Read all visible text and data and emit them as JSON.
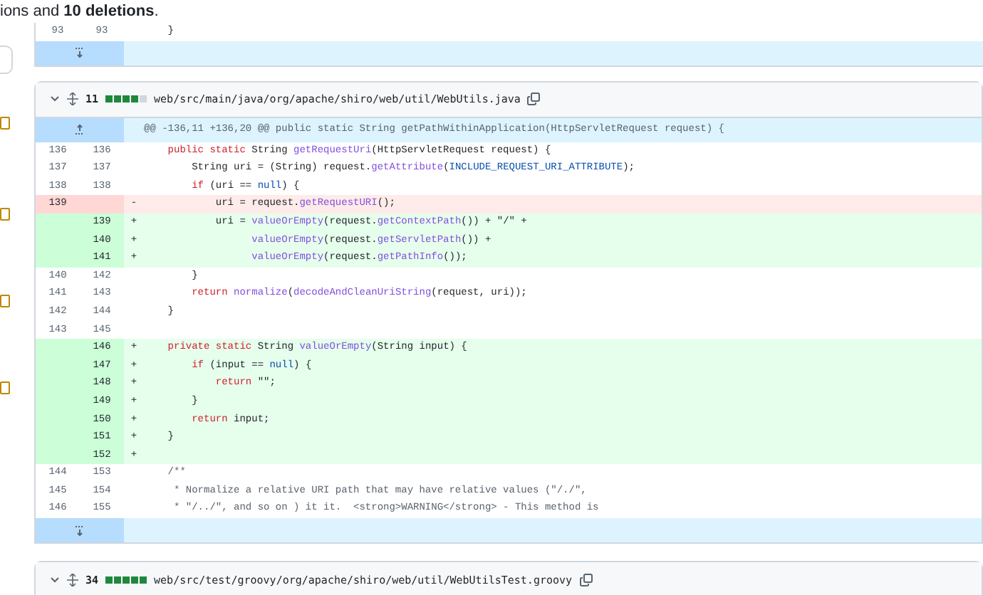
{
  "summary": "ions and **10 deletions**.",
  "top_context": {
    "old": "93",
    "new": "93",
    "code": [
      {
        "text": "    }",
        "kind": "plain"
      }
    ]
  },
  "files": [
    {
      "expanded": true,
      "changes": "11",
      "diffstat": [
        {
          "kind": "added"
        },
        {
          "kind": "added"
        },
        {
          "kind": "added"
        },
        {
          "kind": "added"
        },
        {
          "kind": "neutral"
        }
      ],
      "path": "web/src/main/java/org/apache/shiro/web/util/WebUtils.java",
      "hunk": "@@ -136,11 +136,20 @@ public static String getPathWithinApplication(HttpServletRequest request) {",
      "rows": [
        {
          "kind": "context",
          "old": "136",
          "new": "136",
          "code": [
            {
              "text": "    public static",
              "kind": "keyword"
            },
            {
              "text": " String ",
              "kind": "plain"
            },
            {
              "text": "getRequestUri",
              "kind": "function"
            },
            {
              "text": "(HttpServletRequest request) {",
              "kind": "plain"
            }
          ]
        },
        {
          "kind": "context",
          "old": "137",
          "new": "137",
          "code": [
            {
              "text": "        String uri = (String) request.",
              "kind": "plain"
            },
            {
              "text": "getAttribute",
              "kind": "function"
            },
            {
              "text": "(",
              "kind": "plain"
            },
            {
              "text": "INCLUDE_REQUEST_URI_ATTRIBUTE",
              "kind": "constant"
            },
            {
              "text": ");",
              "kind": "plain"
            }
          ]
        },
        {
          "kind": "context",
          "old": "138",
          "new": "138",
          "code": [
            {
              "text": "        if",
              "kind": "keyword"
            },
            {
              "text": " (uri == ",
              "kind": "plain"
            },
            {
              "text": "null",
              "kind": "constant"
            },
            {
              "text": ") {",
              "kind": "plain"
            }
          ]
        },
        {
          "kind": "deletion",
          "old": "139",
          "marker": "-",
          "code": [
            {
              "text": "            uri = request.",
              "kind": "plain"
            },
            {
              "text": "getRequestURI",
              "kind": "function"
            },
            {
              "text": "();",
              "kind": "plain"
            }
          ]
        },
        {
          "kind": "addition",
          "new": "139",
          "marker": "+",
          "code": [
            {
              "text": "            uri = ",
              "kind": "plain"
            },
            {
              "text": "valueOrEmpty",
              "kind": "function"
            },
            {
              "text": "(request.",
              "kind": "plain"
            },
            {
              "text": "getContextPath",
              "kind": "function"
            },
            {
              "text": "()) + \"/\" +",
              "kind": "plain"
            }
          ]
        },
        {
          "kind": "addition",
          "new": "140",
          "marker": "+",
          "code": [
            {
              "text": "                  valueOrEmpty",
              "kind": "function"
            },
            {
              "text": "(request.",
              "kind": "plain"
            },
            {
              "text": "getServletPath",
              "kind": "function"
            },
            {
              "text": "()) +",
              "kind": "plain"
            }
          ]
        },
        {
          "kind": "addition",
          "new": "141",
          "marker": "+",
          "code": [
            {
              "text": "                  valueOrEmpty",
              "kind": "function"
            },
            {
              "text": "(request.",
              "kind": "plain"
            },
            {
              "text": "getPathInfo",
              "kind": "function"
            },
            {
              "text": "());",
              "kind": "plain"
            }
          ]
        },
        {
          "kind": "context",
          "old": "140",
          "new": "142",
          "code": [
            {
              "text": "        }",
              "kind": "plain"
            }
          ]
        },
        {
          "kind": "context",
          "old": "141",
          "new": "143",
          "code": [
            {
              "text": "        return",
              "kind": "keyword"
            },
            {
              "text": " normalize",
              "kind": "function"
            },
            {
              "text": "(",
              "kind": "plain"
            },
            {
              "text": "decodeAndCleanUriString",
              "kind": "function"
            },
            {
              "text": "(request, uri));",
              "kind": "plain"
            }
          ]
        },
        {
          "kind": "context",
          "old": "142",
          "new": "144",
          "code": [
            {
              "text": "    }",
              "kind": "plain"
            }
          ]
        },
        {
          "kind": "context",
          "old": "143",
          "new": "145",
          "code": []
        },
        {
          "kind": "addition",
          "new": "146",
          "marker": "+",
          "code": [
            {
              "text": "    private static",
              "kind": "keyword"
            },
            {
              "text": " String ",
              "kind": "plain"
            },
            {
              "text": "valueOrEmpty",
              "kind": "function"
            },
            {
              "text": "(String input) {",
              "kind": "plain"
            }
          ]
        },
        {
          "kind": "addition",
          "new": "147",
          "marker": "+",
          "code": [
            {
              "text": "        if",
              "kind": "keyword"
            },
            {
              "text": " (input == ",
              "kind": "plain"
            },
            {
              "text": "null",
              "kind": "constant"
            },
            {
              "text": ") {",
              "kind": "plain"
            }
          ]
        },
        {
          "kind": "addition",
          "new": "148",
          "marker": "+",
          "code": [
            {
              "text": "            return",
              "kind": "keyword"
            },
            {
              "text": " \"\";",
              "kind": "plain"
            }
          ]
        },
        {
          "kind": "addition",
          "new": "149",
          "marker": "+",
          "code": [
            {
              "text": "        }",
              "kind": "plain"
            }
          ]
        },
        {
          "kind": "addition",
          "new": "150",
          "marker": "+",
          "code": [
            {
              "text": "        return",
              "kind": "keyword"
            },
            {
              "text": " input;",
              "kind": "plain"
            }
          ]
        },
        {
          "kind": "addition",
          "new": "151",
          "marker": "+",
          "code": [
            {
              "text": "    }",
              "kind": "plain"
            }
          ]
        },
        {
          "kind": "addition",
          "new": "152",
          "marker": "+",
          "code": []
        },
        {
          "kind": "context",
          "old": "144",
          "new": "153",
          "code": [
            {
              "text": "    /**",
              "kind": "comment"
            }
          ]
        },
        {
          "kind": "context",
          "old": "145",
          "new": "154",
          "code": [
            {
              "text": "     * Normalize a relative URI path that may have relative values (\"/./\",",
              "kind": "comment"
            }
          ]
        },
        {
          "kind": "context",
          "old": "146",
          "new": "155",
          "code": [
            {
              "text": "     * \"/../\", and so on ) it it.  <strong>WARNING</strong> - This method is",
              "kind": "comment"
            }
          ]
        }
      ]
    },
    {
      "expanded": true,
      "changes": "34",
      "diffstat": [
        {
          "kind": "added"
        },
        {
          "kind": "added"
        },
        {
          "kind": "added"
        },
        {
          "kind": "added"
        },
        {
          "kind": "added"
        }
      ],
      "path": "web/src/test/groovy/org/apache/shiro/web/util/WebUtilsTest.groovy"
    }
  ]
}
